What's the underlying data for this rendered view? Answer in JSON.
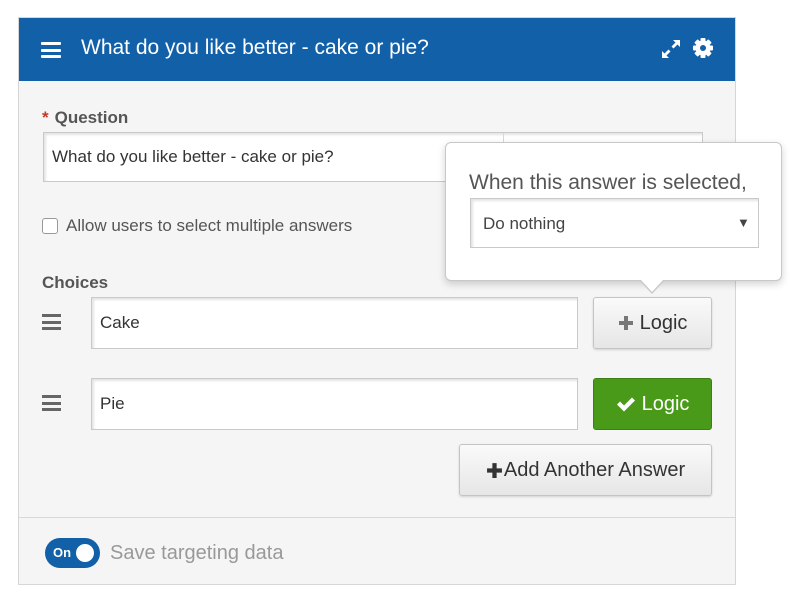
{
  "header": {
    "title": "What do you like better - cake or pie?",
    "menu_icon": "hamburger-menu-icon",
    "expand_icon": "expand-arrows-icon",
    "settings_icon": "gear-icon",
    "color": "#1160a8"
  },
  "question": {
    "required_marker": "*",
    "label": "Question",
    "value": "What do you like better - cake or pie?"
  },
  "multiple_answers": {
    "label": "Allow users to select multiple answers",
    "checked": false
  },
  "choices": {
    "label": "Choices",
    "items": [
      {
        "value": "Cake",
        "logic_label": "Logic",
        "logic_icon": "plus-icon",
        "logic_active": false
      },
      {
        "value": "Pie",
        "logic_label": "Logic",
        "logic_icon": "check-icon",
        "logic_active": true
      }
    ],
    "add_label": "Add Another Answer",
    "add_icon": "plus-icon"
  },
  "footer": {
    "toggle_label": "On",
    "toggle_on": true,
    "save_label": "Save targeting data"
  },
  "popover": {
    "title": "When this answer is selected,",
    "select_value": "Do nothing"
  },
  "colors": {
    "primary": "#1160a8",
    "success": "#4a9a1a",
    "required": "#c0392b"
  }
}
